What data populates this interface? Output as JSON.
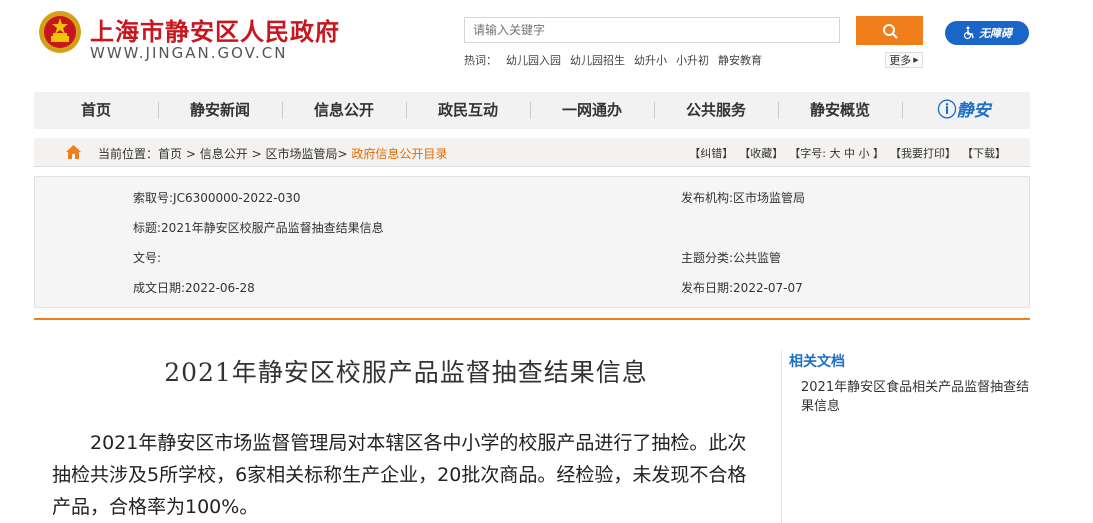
{
  "site": {
    "title": "上海市静安区人民政府",
    "domain": "WWW.JINGAN.GOV.CN"
  },
  "search": {
    "placeholder": "请输入关键字",
    "button_icon": "search-icon"
  },
  "accessibility": {
    "label": "无障碍"
  },
  "hot": {
    "label": "热词：",
    "words": [
      "幼儿园入园",
      "幼儿园招生",
      "幼升小",
      "小升初",
      "静安教育"
    ],
    "more": "更多"
  },
  "nav": {
    "items": [
      "首页",
      "静安新闻",
      "信息公开",
      "政民互动",
      "一网通办",
      "公共服务",
      "静安概览"
    ],
    "logo": "静安"
  },
  "breadcrumb": {
    "prefix": "当前位置",
    "items": [
      "首页",
      "信息公开",
      "区市场监管局"
    ],
    "current": "政府信息公开目录",
    "tools": [
      "【纠错】",
      "【收藏】",
      "【字号: 大 中 小 】",
      "【我要打印】",
      "【下载】"
    ]
  },
  "meta": {
    "index": "索取号:JC6300000-2022-030",
    "publisher": "发布机构:区市场监管局",
    "title": "标题:2021年静安区校服产品监督抽查结果信息",
    "doc_no": "文号:",
    "category": "主题分类:公共监管",
    "created": "成文日期:2022-06-28",
    "published": "发布日期:2022-07-07"
  },
  "article": {
    "title": "2021年静安区校服产品监督抽查结果信息",
    "body": "2021年静安区市场监督管理局对本辖区各中小学的校服产品进行了抽检。此次抽检共涉及5所学校，6家相关标称生产企业，20批次商品。经检验，未发现不合格产品，合格率为100%。"
  },
  "related": {
    "title": "相关文档",
    "items": [
      "2021年静安区食品相关产品监督抽查结果信息"
    ]
  },
  "colors": {
    "brand_red": "#c8161e",
    "accent_orange": "#ef7e1b",
    "link_blue": "#1f6fc7"
  }
}
